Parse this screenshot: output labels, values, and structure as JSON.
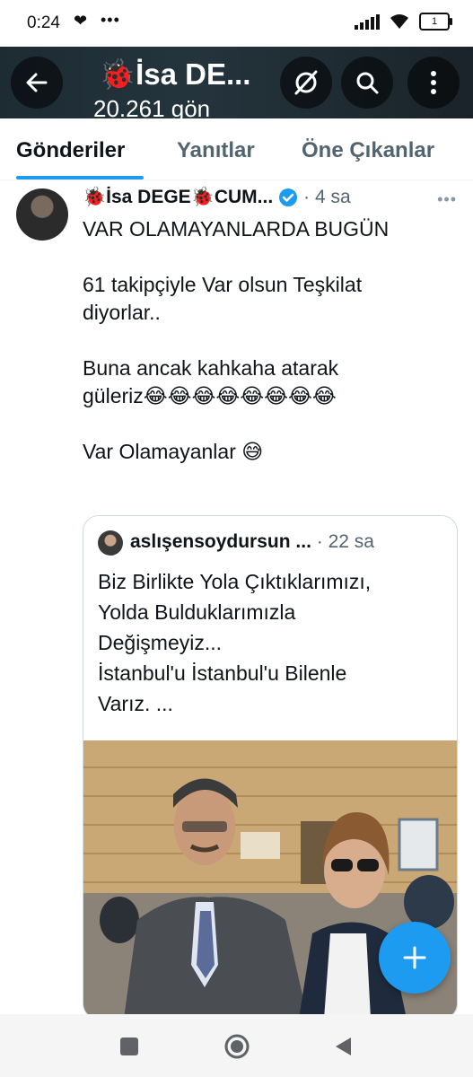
{
  "status_bar": {
    "time": "0:24",
    "dots": "•••",
    "battery": "1"
  },
  "header": {
    "title": "🐞İsa DE...",
    "subtitle": "20.261 gön"
  },
  "tabs": [
    {
      "label": "Gönderiler",
      "active": true
    },
    {
      "label": "Yanıtlar",
      "active": false
    },
    {
      "label": "Öne Çıkanlar",
      "active": false
    }
  ],
  "tweet": {
    "author": "🐞İsa DEGE🐞CUM...",
    "meta": "· 4 sa",
    "lines": [
      "VAR OLAMAYANLARDA BUGÜN",
      "",
      "61 takipçiyle Var olsun Teşkilat",
      "diyorlar..",
      "",
      "Buna ancak kahkaha atarak",
      "güleriz😂😂😂😂😂😂😂😂",
      "",
      "Var Olamayanlar 😅"
    ]
  },
  "quote": {
    "author": "aslışensoydursun ...",
    "meta": "· 22 sa",
    "lines": [
      "Biz Birlikte Yola Çıktıklarımızı,",
      "Yolda Bulduklarımızla",
      "Değişmeyiz...",
      "İstanbul'u İstanbul'u Bilenle",
      "Varız.  ..."
    ]
  },
  "colors": {
    "accent": "#1d9bf0",
    "text": "#0f1419",
    "muted": "#536471"
  }
}
